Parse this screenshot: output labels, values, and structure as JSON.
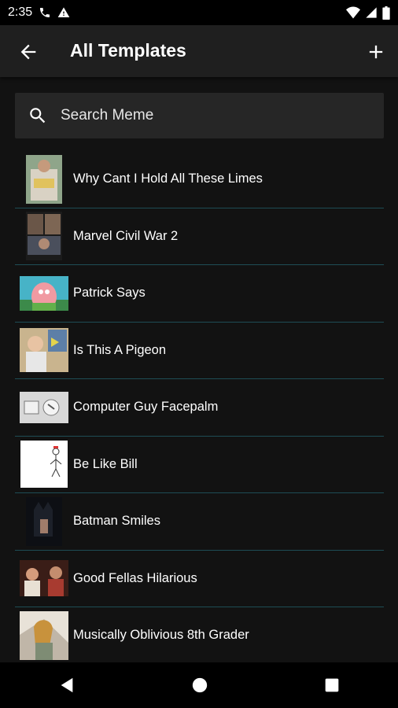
{
  "status": {
    "time": "2:35"
  },
  "app_bar": {
    "title": "All Templates"
  },
  "search": {
    "placeholder": "Search Meme"
  },
  "templates": [
    {
      "title": "Why Cant I Hold All These Limes"
    },
    {
      "title": "Marvel Civil War 2"
    },
    {
      "title": "Patrick Says"
    },
    {
      "title": "Is This A Pigeon"
    },
    {
      "title": "Computer Guy Facepalm"
    },
    {
      "title": "Be Like Bill"
    },
    {
      "title": "Batman Smiles"
    },
    {
      "title": "Good Fellas Hilarious"
    },
    {
      "title": "Musically Oblivious 8th Grader"
    }
  ],
  "colors": {
    "divider": "#1e4d55",
    "app_bar": "#1f1f1f",
    "background": "#121212"
  }
}
